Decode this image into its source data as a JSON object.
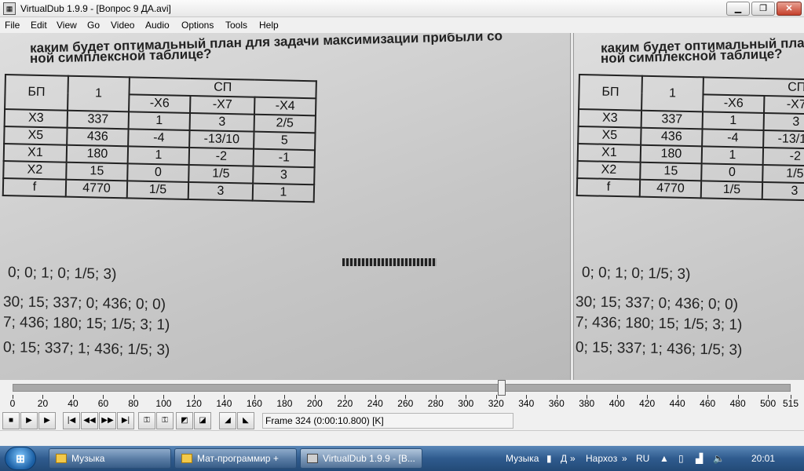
{
  "window": {
    "title": "VirtualDub 1.9.9 - [Вопрос 9 ДА.avi]",
    "controls": {
      "minimize": "▁",
      "maximize": "❐",
      "close": "✕"
    }
  },
  "menu": [
    "File",
    "Edit",
    "View",
    "Go",
    "Video",
    "Audio",
    "Options",
    "Tools",
    "Help"
  ],
  "video": {
    "heading_line1": "каким будет оптимальный план для задачи максимизации прибыли со",
    "heading_line2": "ной симплексной таблице?",
    "table": {
      "header_bp": "БП",
      "header_one": "1",
      "header_sp": "СП",
      "sub_headers": [
        "-X6",
        "-X7",
        "-X4"
      ],
      "rows": [
        {
          "bp": "X3",
          "one": "337",
          "c1": "1",
          "c2": "3",
          "c3": "2/5"
        },
        {
          "bp": "X5",
          "one": "436",
          "c1": "-4",
          "c2": "-13/10",
          "c3": "5"
        },
        {
          "bp": "X1",
          "one": "180",
          "c1": "1",
          "c2": "-2",
          "c3": "-1"
        },
        {
          "bp": "X2",
          "one": "15",
          "c1": "0",
          "c2": "1/5",
          "c3": "3"
        },
        {
          "bp": "f",
          "one": "4770",
          "c1": "1/5",
          "c2": "3",
          "c3": "1"
        }
      ]
    },
    "answers": [
      "0; 0; 1; 0; 1/5; 3)",
      "30; 15; 337; 0; 436; 0; 0)",
      "7; 436; 180; 15; 1/5; 3; 1)",
      "0; 15; 337; 1; 436; 1/5; 3)"
    ]
  },
  "timeline": {
    "ticks": [
      0,
      20,
      40,
      60,
      80,
      100,
      120,
      140,
      160,
      180,
      200,
      220,
      240,
      260,
      280,
      300,
      320,
      340,
      360,
      380,
      400,
      420,
      440,
      460,
      480,
      500,
      515
    ],
    "max": 515,
    "position": 324
  },
  "toolbar": {
    "frame_info": "Frame 324 (0:00:10.800) [K]"
  },
  "taskbar": {
    "tasks": [
      {
        "label": "Музыка",
        "icon": "folder-icon"
      },
      {
        "label": "Мат-программир +",
        "icon": "folder-icon"
      },
      {
        "label": "VirtualDub 1.9.9 - [В...",
        "icon": "virtualdub-icon"
      }
    ],
    "tray": {
      "music": "Музыка",
      "music_d": "Д",
      "narhoz": "Нарxoз",
      "lang": "RU",
      "clock": "20:01"
    }
  }
}
